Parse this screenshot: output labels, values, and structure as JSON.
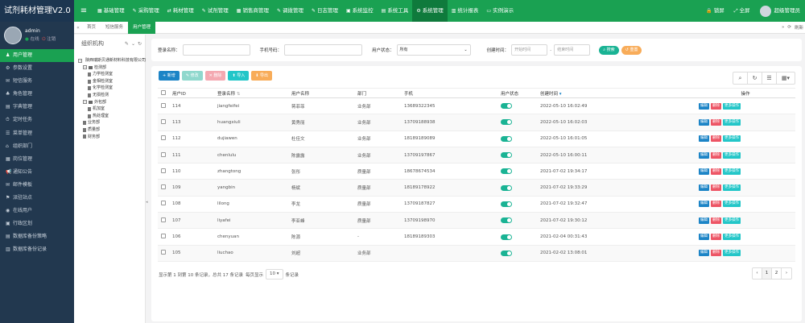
{
  "app": {
    "title": "试剂耗材管理V2.0"
  },
  "topnav": {
    "items": [
      {
        "label": "基础管理",
        "active": false
      },
      {
        "label": "采购管理",
        "active": false
      },
      {
        "label": "耗材管理",
        "active": false
      },
      {
        "label": "试剂管理",
        "active": false
      },
      {
        "label": "销售商管理",
        "active": false
      },
      {
        "label": "调拨管理",
        "active": false
      },
      {
        "label": "日志管理",
        "active": false
      },
      {
        "label": "系统监控",
        "active": false
      },
      {
        "label": "系统工具",
        "active": false
      },
      {
        "label": "系统管理",
        "active": true
      },
      {
        "label": "统计报表",
        "active": false
      },
      {
        "label": "实例演示",
        "active": false
      }
    ],
    "lock": "锁屏",
    "fullscreen": "全屏",
    "user": "超级管理员"
  },
  "user": {
    "name": "admin",
    "status": "在线",
    "logout": "注销"
  },
  "sidebar": {
    "items": [
      {
        "label": "用户管理",
        "active": true
      },
      {
        "label": "参数设置"
      },
      {
        "label": "短信服务"
      },
      {
        "label": "角色管理"
      },
      {
        "label": "字典管理"
      },
      {
        "label": "定时任务"
      },
      {
        "label": "菜单管理"
      },
      {
        "label": "组织部门"
      },
      {
        "label": "岗位管理"
      },
      {
        "label": "通知公告"
      },
      {
        "label": "邮件模板"
      },
      {
        "label": "派驻站点"
      },
      {
        "label": "在线用户"
      },
      {
        "label": "行政区划"
      },
      {
        "label": "数据库备份策略"
      },
      {
        "label": "数据库备份记录"
      }
    ]
  },
  "tabs": {
    "items": [
      {
        "label": "首页",
        "active": false
      },
      {
        "label": "短信服务",
        "active": false
      },
      {
        "label": "用户管理",
        "active": true
      }
    ],
    "refresh": "刷新"
  },
  "org": {
    "title": "组织机构",
    "tree": [
      {
        "label": "陕西瑞斯贝通新材料科技有限公司",
        "level": 0,
        "kind": "branch"
      },
      {
        "label": "检测部",
        "level": 1,
        "kind": "branch"
      },
      {
        "label": "力学检测室",
        "level": 2,
        "kind": "leaf"
      },
      {
        "label": "金相检测室",
        "level": 2,
        "kind": "leaf"
      },
      {
        "label": "化学检测室",
        "level": 2,
        "kind": "leaf"
      },
      {
        "label": "无损检测",
        "level": 2,
        "kind": "leaf"
      },
      {
        "label": "外包部",
        "level": 1,
        "kind": "branch"
      },
      {
        "label": "机加室",
        "level": 2,
        "kind": "leaf"
      },
      {
        "label": "热处理室",
        "level": 2,
        "kind": "leaf"
      },
      {
        "label": "业务部",
        "level": 1,
        "kind": "leaf"
      },
      {
        "label": "质量部",
        "level": 1,
        "kind": "leaf"
      },
      {
        "label": "财务部",
        "level": 1,
        "kind": "leaf"
      }
    ]
  },
  "search": {
    "login_label": "登录名称：",
    "phone_label": "手机号码：",
    "status_label": "用户状态：",
    "status_value": "所有",
    "time_label": "创建时间：",
    "start_placeholder": "开始时间",
    "end_placeholder": "结束时间",
    "search_btn": "搜索",
    "reset_btn": "重置"
  },
  "toolbar": {
    "add": "新增",
    "edit": "修改",
    "delete": "删除",
    "import": "导入",
    "export": "导出"
  },
  "table": {
    "headers": [
      "用户ID",
      "登录名称",
      "用户名称",
      "部门",
      "手机",
      "用户状态",
      "创建时间",
      "操作"
    ],
    "rows": [
      {
        "id": "114",
        "login": "jiangfeifei",
        "name": "蒋菲菲",
        "dept": "业务部",
        "phone": "13689322345",
        "created": "2022-05-10 16:02:49"
      },
      {
        "id": "113",
        "login": "huangxiuli",
        "name": "黄秀丽",
        "dept": "业务部",
        "phone": "13709188938",
        "created": "2022-05-10 16:02:03"
      },
      {
        "id": "112",
        "login": "dujiawen",
        "name": "杜佳文",
        "dept": "业务部",
        "phone": "18189189089",
        "created": "2022-05-10 16:01:05"
      },
      {
        "id": "111",
        "login": "chenlulu",
        "name": "陈露露",
        "dept": "业务部",
        "phone": "13709197867",
        "created": "2022-05-10 16:00:11"
      },
      {
        "id": "110",
        "login": "zhangtong",
        "name": "张彤",
        "dept": "质量部",
        "phone": "18678674534",
        "created": "2021-07-02 19:34:17"
      },
      {
        "id": "109",
        "login": "yangbin",
        "name": "杨斌",
        "dept": "质量部",
        "phone": "18189178922",
        "created": "2021-07-02 19:33:29"
      },
      {
        "id": "108",
        "login": "lilong",
        "name": "李龙",
        "dept": "质量部",
        "phone": "13709187827",
        "created": "2021-07-02 19:32:47"
      },
      {
        "id": "107",
        "login": "liyafei",
        "name": "李亚峰",
        "dept": "质量部",
        "phone": "13709198970",
        "created": "2021-07-02 19:30:12"
      },
      {
        "id": "106",
        "login": "chenyuan",
        "name": "陈源",
        "dept": "-",
        "phone": "18189189303",
        "created": "2021-02-04 00:31:43"
      },
      {
        "id": "105",
        "login": "liuchao",
        "name": "刘超",
        "dept": "业务部",
        "phone": "",
        "created": "2021-02-02 13:08:01"
      }
    ],
    "ops": {
      "edit": "编辑",
      "delete": "删除",
      "more": "更多操作"
    }
  },
  "footer": {
    "summary": "显示第 1 到第 10 条记录，总共 17 条记录",
    "per_page_label": "每页显示",
    "per_page": "10",
    "per_page_suffix": "条记录"
  },
  "pager": {
    "prev": "‹",
    "pages": [
      "1",
      "2"
    ],
    "next": "›"
  },
  "colors": {
    "brand_green": "#1aa152",
    "sidebar": "#22384f",
    "primary_blue": "#1c84c6",
    "danger": "#ed5565",
    "info": "#23c6c8",
    "toggle": "#1ab394"
  }
}
